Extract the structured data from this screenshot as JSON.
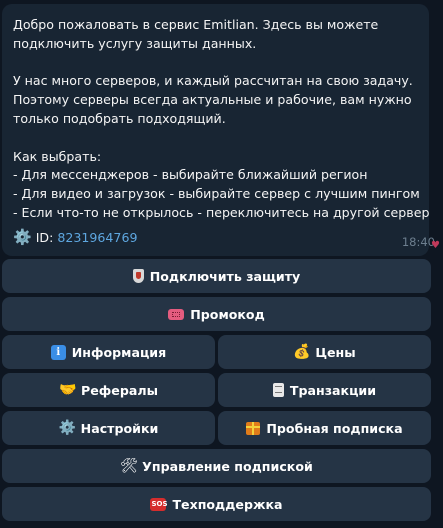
{
  "message": {
    "lines": [
      "Добро пожаловать в сервис Emitlian. Здесь вы можете",
      "подключить услугу защиты данных.",
      "",
      "У нас много серверов, и каждый рассчитан на свою задачу.",
      "Поэтому серверы всегда актуальные и рабочие, вам нужно",
      "только подобрать подходящий.",
      "",
      "Как выбрать:",
      "- Для мессенджеров - выбирайте ближайший регион",
      "- Для видео и загрузок - выбирайте сервер с лучшим пингом",
      "- Если что-то не открылось - переключитесь на другой сервер"
    ],
    "id_label": "ID:",
    "id_value": "8231964769",
    "time": "18:40"
  },
  "buttons": {
    "connect": "Подключить защиту",
    "promo": "Промокод",
    "info": "Информация",
    "prices": "Цены",
    "referrals": "Рефералы",
    "transactions": "Транзакции",
    "settings": "Настройки",
    "trial": "Пробная подписка",
    "manage": "Управление подпиской",
    "support": "Техподдержка"
  },
  "icons": {
    "connect": "shield-icon",
    "promo": "ticket-icon",
    "info": "info-icon",
    "prices": "money-bag-icon",
    "referrals": "handshake-icon",
    "transactions": "receipt-icon",
    "settings": "gear-icon",
    "trial": "gift-icon",
    "manage": "tools-icon",
    "support": "sos-icon"
  },
  "colors": {
    "background": "#0e1621",
    "bubble": "#182533",
    "button": "#253445",
    "link": "#5ea7e0"
  }
}
